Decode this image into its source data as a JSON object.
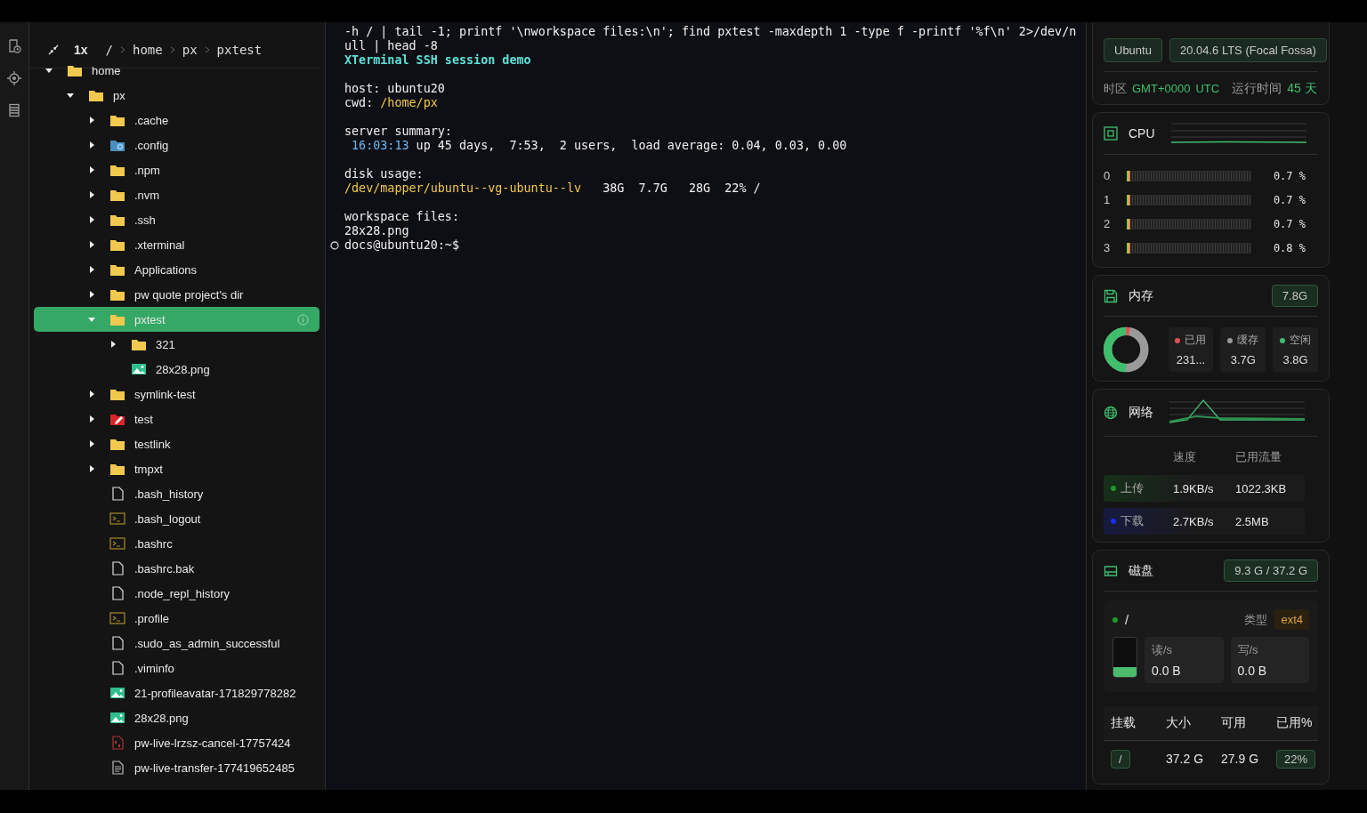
{
  "rail": {
    "icons": [
      {
        "kind": "history"
      },
      {
        "kind": "locate"
      },
      {
        "kind": "list"
      }
    ]
  },
  "tree_header": {
    "zoom": "1x",
    "breadcrumb": [
      "/",
      "home",
      "px",
      "pxtest"
    ]
  },
  "tree": [
    {
      "name": "home",
      "kind": "folder",
      "expanded": true,
      "selected": false,
      "children": [
        {
          "name": "px",
          "kind": "folder",
          "expanded": true,
          "selected": false,
          "children": [
            {
              "name": ".cache",
              "kind": "folder",
              "expanded": false,
              "selected": false
            },
            {
              "name": ".config",
              "kind": "config-folder",
              "expanded": false,
              "selected": false
            },
            {
              "name": ".npm",
              "kind": "folder",
              "expanded": false,
              "selected": false
            },
            {
              "name": ".nvm",
              "kind": "folder",
              "expanded": false,
              "selected": false
            },
            {
              "name": ".ssh",
              "kind": "folder",
              "expanded": false,
              "selected": false
            },
            {
              "name": ".xterminal",
              "kind": "folder",
              "expanded": false,
              "selected": false
            },
            {
              "name": "Applications",
              "kind": "folder",
              "expanded": false,
              "selected": false
            },
            {
              "name": "pw quote project's dir",
              "kind": "folder",
              "expanded": false,
              "selected": false
            },
            {
              "name": "pxtest",
              "kind": "folder",
              "expanded": true,
              "selected": true,
              "children": [
                {
                  "name": "321",
                  "kind": "folder",
                  "expanded": false,
                  "selected": false
                },
                {
                  "name": "28x28.png",
                  "kind": "image",
                  "selected": false
                }
              ]
            },
            {
              "name": "symlink-test",
              "kind": "folder",
              "expanded": false,
              "selected": false
            },
            {
              "name": "test",
              "kind": "locked-folder",
              "expanded": false,
              "selected": false
            },
            {
              "name": "testlink",
              "kind": "folder",
              "expanded": false,
              "selected": false
            },
            {
              "name": "tmpxt",
              "kind": "folder",
              "expanded": false,
              "selected": false
            },
            {
              "name": ".bash_history",
              "kind": "file",
              "selected": false
            },
            {
              "name": ".bash_logout",
              "kind": "script",
              "selected": false
            },
            {
              "name": ".bashrc",
              "kind": "script",
              "selected": false
            },
            {
              "name": ".bashrc.bak",
              "kind": "file",
              "selected": false
            },
            {
              "name": ".node_repl_history",
              "kind": "file",
              "selected": false
            },
            {
              "name": ".profile",
              "kind": "script",
              "selected": false
            },
            {
              "name": ".sudo_as_admin_successful",
              "kind": "file",
              "selected": false
            },
            {
              "name": ".viminfo",
              "kind": "file",
              "selected": false
            },
            {
              "name": "21-profileavatar-171829778282",
              "kind": "image",
              "selected": false
            },
            {
              "name": "28x28.png",
              "kind": "image",
              "selected": false
            },
            {
              "name": "pw-live-lrzsz-cancel-17757424",
              "kind": "binary",
              "selected": false
            },
            {
              "name": "pw-live-transfer-177419652485",
              "kind": "text",
              "selected": false
            }
          ]
        }
      ]
    }
  ],
  "terminal": {
    "lines": [
      {
        "blank_before": false,
        "segments": [
          {
            "text": "-h / | tail -1; printf '\\nworkspace files:\\n'; find pxtest -maxdepth 1 -type f -printf '%f\\n' 2>/dev/n",
            "kind": "plain"
          }
        ]
      },
      {
        "blank_before": false,
        "segments": [
          {
            "text": "ull | head -8",
            "kind": "plain"
          }
        ]
      },
      {
        "blank_before": false,
        "segments": [
          {
            "text": "XTerminal SSH session demo",
            "kind": "title"
          }
        ]
      },
      {
        "blank_before": true,
        "segments": [
          {
            "text": "host: ubuntu20",
            "kind": "plain"
          }
        ]
      },
      {
        "blank_before": false,
        "segments": [
          {
            "text": "cwd: ",
            "kind": "plain"
          },
          {
            "text": "/home/px",
            "kind": "path"
          }
        ]
      },
      {
        "blank_before": true,
        "segments": [
          {
            "text": "server summary:",
            "kind": "plain"
          }
        ]
      },
      {
        "blank_before": false,
        "segments": [
          {
            "text": " 16:03:13",
            "kind": "time"
          },
          {
            "text": " up 45 days,  7:53,  2 users,  load average: 0.04, 0.03, 0.00",
            "kind": "plain"
          }
        ]
      },
      {
        "blank_before": true,
        "segments": [
          {
            "text": "disk usage:",
            "kind": "plain"
          }
        ]
      },
      {
        "blank_before": false,
        "segments": [
          {
            "text": "/dev/mapper/ubuntu--vg-ubuntu--lv",
            "kind": "path"
          },
          {
            "text": "   38G  7.7G   28G  22% /",
            "kind": "plain"
          }
        ]
      },
      {
        "blank_before": true,
        "segments": [
          {
            "text": "workspace files:",
            "kind": "plain"
          }
        ]
      },
      {
        "blank_before": false,
        "segments": [
          {
            "text": "28x28.png",
            "kind": "plain"
          }
        ]
      }
    ],
    "prompt": "docs@ubuntu20:~$"
  },
  "system": {
    "os": "Ubuntu",
    "version": "20.04.6 LTS (Focal Fossa)",
    "timezone_label": "时区",
    "timezone": "GMT+0000",
    "tz_name": "UTC",
    "uptime_label": "运行时间",
    "uptime": "45 天"
  },
  "cpu": {
    "title": "CPU",
    "cores": [
      {
        "name": "0",
        "level": 0.007,
        "reading": "0.7 %"
      },
      {
        "name": "1",
        "level": 0.007,
        "reading": "0.7 %"
      },
      {
        "name": "2",
        "level": 0.007,
        "reading": "0.7 %"
      },
      {
        "name": "3",
        "level": 0.008,
        "reading": "0.8 %"
      }
    ]
  },
  "memory": {
    "title": "内存",
    "total": "7.8G",
    "items": [
      {
        "label": "已用",
        "value": "231...",
        "color": "#e05252"
      },
      {
        "label": "缓存",
        "value": "3.7G",
        "color": "#9a9a9a"
      },
      {
        "label": "空闲",
        "value": "3.8G",
        "color": "#3fbf6e"
      }
    ]
  },
  "network": {
    "title": "网络",
    "columns": [
      "速度",
      "已用流量"
    ],
    "rows": [
      {
        "label": "上传",
        "speed": "1.9KB/s",
        "total": "1022.3KB",
        "color": "#1f9a2a"
      },
      {
        "label": "下载",
        "speed": "2.7KB/s",
        "total": "2.5MB",
        "color": "#1a2ee8"
      }
    ]
  },
  "disk": {
    "title": "磁盘",
    "usage": "9.3 G / 37.2 G",
    "mount": "/",
    "type_label": "类型",
    "type": "ext4",
    "level": 0.25,
    "read_label": "读/s",
    "read": "0.0 B",
    "write_label": "写/s",
    "write": "0.0 B",
    "columns": [
      "挂载",
      "大小",
      "可用",
      "已用%"
    ],
    "rows": [
      {
        "mount": "/",
        "size": "37.2 G",
        "free": "27.9 G",
        "used": "22%"
      }
    ]
  }
}
